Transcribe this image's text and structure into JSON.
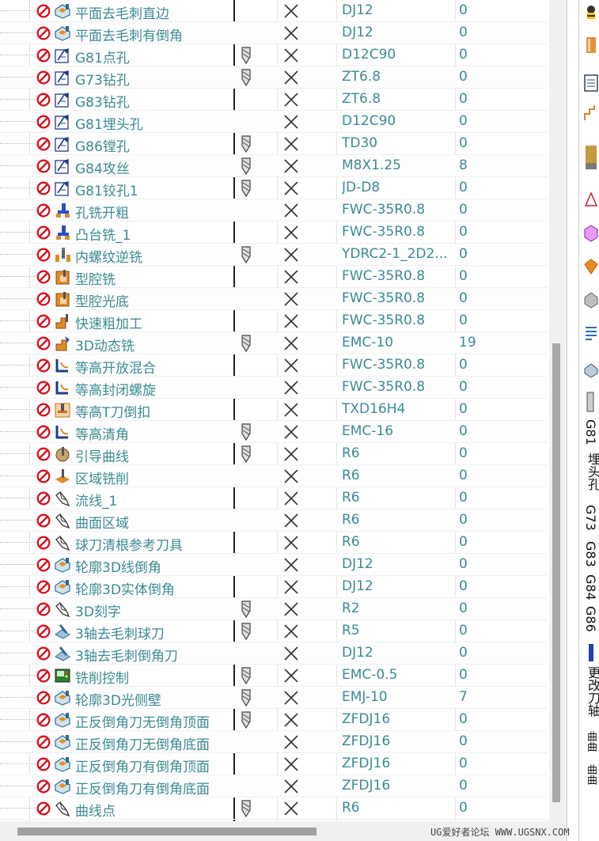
{
  "operations": [
    {
      "name": "平面去毛刺直边",
      "icon": "chamfer-part-icon",
      "toolpath": false,
      "tool": "DJ12",
      "count": "0"
    },
    {
      "name": "平面去毛刺有倒角",
      "icon": "chamfer-part-icon",
      "toolpath": false,
      "tool": "DJ12",
      "count": "0"
    },
    {
      "name": "G81点孔",
      "icon": "drill-cycle-icon",
      "toolpath": true,
      "tool": "D12C90",
      "count": "0"
    },
    {
      "name": "G73钻孔",
      "icon": "drill-cycle-icon",
      "toolpath": true,
      "tool": "ZT6.8",
      "count": "0"
    },
    {
      "name": "G83钻孔",
      "icon": "drill-cycle-icon",
      "toolpath": false,
      "tool": "ZT6.8",
      "count": "0"
    },
    {
      "name": "G81埋头孔",
      "icon": "drill-cycle-icon",
      "toolpath": false,
      "tool": "D12C90",
      "count": "0"
    },
    {
      "name": "G86镗孔",
      "icon": "drill-cycle-icon",
      "toolpath": true,
      "tool": "TD30",
      "count": "0"
    },
    {
      "name": "G84攻丝",
      "icon": "drill-cycle-icon",
      "toolpath": true,
      "tool": "M8X1.25",
      "count": "8"
    },
    {
      "name": "G81铰孔1",
      "icon": "drill-cycle-icon",
      "toolpath": true,
      "tool": "JD-D8",
      "count": "0"
    },
    {
      "name": "孔铣开粗",
      "icon": "hole-mill-icon",
      "toolpath": false,
      "tool": "FWC-35R0.8",
      "count": "0"
    },
    {
      "name": "凸台铣_1",
      "icon": "hole-mill-icon",
      "toolpath": false,
      "tool": "FWC-35R0.8",
      "count": "0"
    },
    {
      "name": "内螺纹逆铣",
      "icon": "thread-mill-icon",
      "toolpath": true,
      "tool": "YDRC2-1_2D2...",
      "count": "0"
    },
    {
      "name": "型腔铣",
      "icon": "cavity-mill-icon",
      "toolpath": false,
      "tool": "FWC-35R0.8",
      "count": "0"
    },
    {
      "name": "型腔光底",
      "icon": "cavity-mill-icon",
      "toolpath": false,
      "tool": "FWC-35R0.8",
      "count": "0"
    },
    {
      "name": "快速粗加工",
      "icon": "rough-mill-icon",
      "toolpath": false,
      "tool": "FWC-35R0.8",
      "count": "0"
    },
    {
      "name": "3D动态铣",
      "icon": "dynamic-mill-icon",
      "toolpath": true,
      "tool": "EMC-10",
      "count": "19"
    },
    {
      "name": "等高开放混合",
      "icon": "zlevel-icon",
      "toolpath": false,
      "tool": "FWC-35R0.8",
      "count": "0"
    },
    {
      "name": "等高封闭螺旋",
      "icon": "zlevel-icon",
      "toolpath": false,
      "tool": "FWC-35R0.8",
      "count": "0"
    },
    {
      "name": "等高T刀倒扣",
      "icon": "t-cutter-icon",
      "toolpath": false,
      "tool": "TXD16H4",
      "count": "0"
    },
    {
      "name": "等高清角",
      "icon": "zlevel-icon",
      "toolpath": true,
      "tool": "EMC-16",
      "count": "0"
    },
    {
      "name": "引导曲线",
      "icon": "guide-curve-icon",
      "toolpath": true,
      "tool": "R6",
      "count": "0"
    },
    {
      "name": "区域铣削",
      "icon": "area-mill-icon",
      "toolpath": false,
      "tool": "R6",
      "count": "0"
    },
    {
      "name": "流线_1",
      "icon": "surface-mill-icon",
      "toolpath": false,
      "tool": "R6",
      "count": "0"
    },
    {
      "name": "曲面区域",
      "icon": "surface-mill-icon",
      "toolpath": false,
      "tool": "R6",
      "count": "0"
    },
    {
      "name": "球刀清根参考刀具",
      "icon": "surface-mill-icon",
      "toolpath": false,
      "tool": "R6",
      "count": "0"
    },
    {
      "name": "轮廓3D线倒角",
      "icon": "chamfer-part-icon",
      "toolpath": false,
      "tool": "DJ12",
      "count": "0"
    },
    {
      "name": "轮廓3D实体倒角",
      "icon": "chamfer-part-icon",
      "toolpath": false,
      "tool": "DJ12",
      "count": "0"
    },
    {
      "name": "3D刻字",
      "icon": "surface-mill-icon",
      "toolpath": true,
      "tool": "R2",
      "count": "0"
    },
    {
      "name": "3轴去毛刺球刀",
      "icon": "deburr-icon",
      "toolpath": true,
      "tool": "R5",
      "count": "0"
    },
    {
      "name": "3轴去毛刺倒角刀",
      "icon": "deburr-icon",
      "toolpath": false,
      "tool": "DJ12",
      "count": "0"
    },
    {
      "name": "铣削控制",
      "icon": "mill-control-icon",
      "toolpath": true,
      "tool": "EMC-0.5",
      "count": "0"
    },
    {
      "name": "轮廓3D光侧壁",
      "icon": "chamfer-part-icon",
      "toolpath": true,
      "tool": "EMJ-10",
      "count": "7"
    },
    {
      "name": "正反倒角刀无倒角顶面",
      "icon": "chamfer-part-icon",
      "toolpath": true,
      "tool": "ZFDJ16",
      "count": "0"
    },
    {
      "name": "正反倒角刀无倒角底面",
      "icon": "chamfer-part-icon",
      "toolpath": false,
      "tool": "ZFDJ16",
      "count": "0"
    },
    {
      "name": "正反倒角刀有倒角顶面",
      "icon": "chamfer-part-icon",
      "toolpath": false,
      "tool": "ZFDJ16",
      "count": "0"
    },
    {
      "name": "正反倒角刀有倒角底面",
      "icon": "chamfer-part-icon",
      "toolpath": false,
      "tool": "ZFDJ16",
      "count": "0"
    },
    {
      "name": "曲线点",
      "icon": "surface-mill-icon",
      "toolpath": true,
      "tool": "R6",
      "count": "0"
    }
  ],
  "status_icons": {
    "no_operation": "no-entry-icon",
    "toolpath": "toolpath-icon",
    "not_generated": "x-mark-icon"
  },
  "right_toolbar": {
    "vertical_labels": [
      "G81",
      "埋头孔",
      "G73",
      "G83",
      "G84",
      "G86",
      "镗孔",
      "更改刀轴",
      "曲曲",
      "曲曲"
    ]
  },
  "colors": {
    "text_accent": "#3c8a94",
    "no_entry_red": "#d6101f",
    "scrollbar": "#f0f0f0",
    "thumb": "#a8a8a8"
  },
  "watermark": "UG爱好者论坛 WWW.UGSNX.COM"
}
